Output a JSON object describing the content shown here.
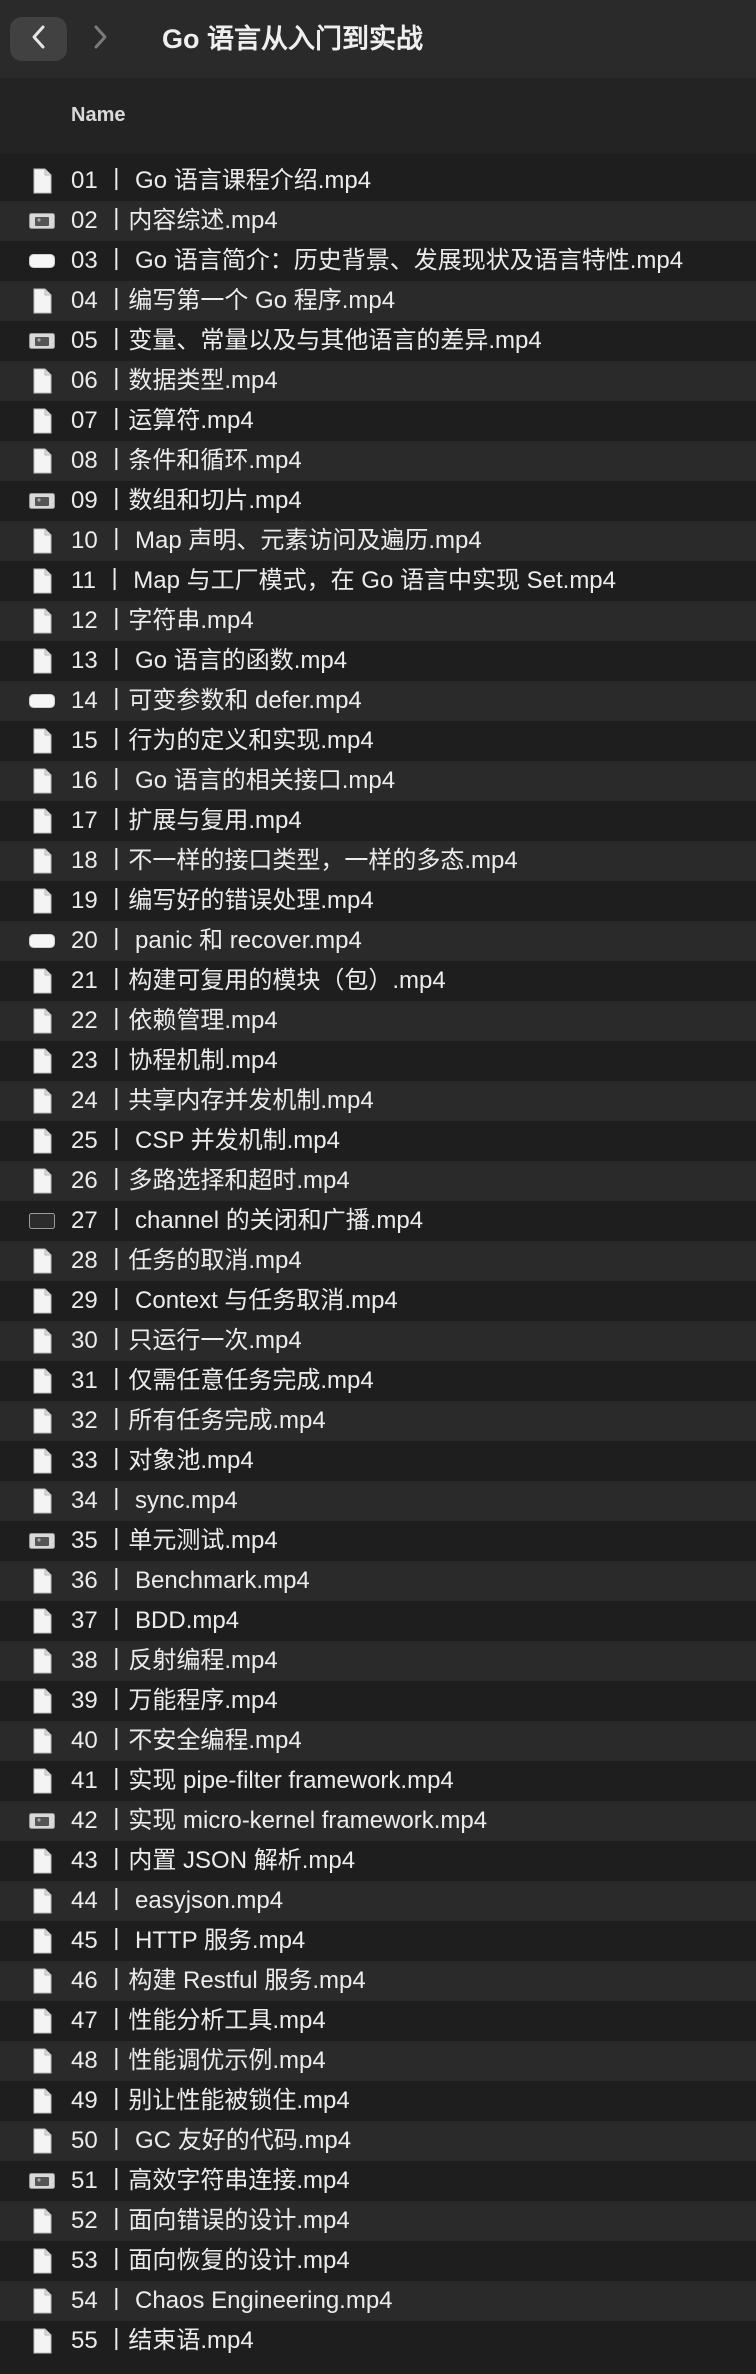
{
  "window": {
    "title": "Go 语言从入门到实战",
    "back_icon": "chevron-left-icon",
    "forward_icon": "chevron-right-icon"
  },
  "header": {
    "name_column": "Name"
  },
  "files": [
    {
      "name": "01 丨 Go 语言课程介绍.mp4",
      "icon": "document-icon"
    },
    {
      "name": "02 丨内容综述.mp4",
      "icon": "image-thumbnail-icon"
    },
    {
      "name": "03 丨 Go 语言简介：历史背景、发展现状及语言特性.mp4",
      "icon": "blank-thumbnail-icon"
    },
    {
      "name": "04 丨编写第一个 Go 程序.mp4",
      "icon": "document-icon"
    },
    {
      "name": "05 丨变量、常量以及与其他语言的差异.mp4",
      "icon": "image-thumbnail-icon"
    },
    {
      "name": "06 丨数据类型.mp4",
      "icon": "document-icon"
    },
    {
      "name": "07 丨运算符.mp4",
      "icon": "document-icon"
    },
    {
      "name": "08 丨条件和循环.mp4",
      "icon": "document-icon"
    },
    {
      "name": "09 丨数组和切片.mp4",
      "icon": "image-thumbnail-icon"
    },
    {
      "name": "10 丨 Map 声明、元素访问及遍历.mp4",
      "icon": "document-icon"
    },
    {
      "name": "11 丨 Map 与工厂模式，在 Go 语言中实现 Set.mp4",
      "icon": "document-icon"
    },
    {
      "name": "12 丨字符串.mp4",
      "icon": "document-icon"
    },
    {
      "name": "13 丨 Go 语言的函数.mp4",
      "icon": "document-icon"
    },
    {
      "name": "14 丨可变参数和 defer.mp4",
      "icon": "blank-thumbnail-icon"
    },
    {
      "name": "15 丨行为的定义和实现.mp4",
      "icon": "document-icon"
    },
    {
      "name": "16 丨 Go 语言的相关接口.mp4",
      "icon": "document-icon"
    },
    {
      "name": "17 丨扩展与复用.mp4",
      "icon": "document-icon"
    },
    {
      "name": "18 丨不一样的接口类型，一样的多态.mp4",
      "icon": "document-icon"
    },
    {
      "name": "19 丨编写好的错误处理.mp4",
      "icon": "document-icon"
    },
    {
      "name": "20 丨 panic 和 recover.mp4",
      "icon": "blank-thumbnail-icon"
    },
    {
      "name": "21 丨构建可复用的模块（包）.mp4",
      "icon": "document-icon"
    },
    {
      "name": "22 丨依赖管理.mp4",
      "icon": "document-icon"
    },
    {
      "name": "23 丨协程机制.mp4",
      "icon": "document-icon"
    },
    {
      "name": "24 丨共享内存并发机制.mp4",
      "icon": "document-icon"
    },
    {
      "name": "25 丨 CSP 并发机制.mp4",
      "icon": "document-icon"
    },
    {
      "name": "26 丨多路选择和超时.mp4",
      "icon": "document-icon"
    },
    {
      "name": "27 丨 channel 的关闭和广播.mp4",
      "icon": "dark-thumbnail-icon"
    },
    {
      "name": "28 丨任务的取消.mp4",
      "icon": "document-icon"
    },
    {
      "name": "29 丨 Context 与任务取消.mp4",
      "icon": "document-icon"
    },
    {
      "name": "30 丨只运行一次.mp4",
      "icon": "document-icon"
    },
    {
      "name": "31 丨仅需任意任务完成.mp4",
      "icon": "document-icon"
    },
    {
      "name": "32 丨所有任务完成.mp4",
      "icon": "document-icon"
    },
    {
      "name": "33 丨对象池.mp4",
      "icon": "document-icon"
    },
    {
      "name": "34 丨 sync.mp4",
      "icon": "document-icon"
    },
    {
      "name": "35 丨单元测试.mp4",
      "icon": "image-thumbnail-icon"
    },
    {
      "name": "36 丨 Benchmark.mp4",
      "icon": "document-icon"
    },
    {
      "name": "37 丨 BDD.mp4",
      "icon": "document-icon"
    },
    {
      "name": "38 丨反射编程.mp4",
      "icon": "document-icon"
    },
    {
      "name": "39 丨万能程序.mp4",
      "icon": "document-icon"
    },
    {
      "name": "40 丨不安全编程.mp4",
      "icon": "document-icon"
    },
    {
      "name": "41 丨实现 pipe-filter framework.mp4",
      "icon": "document-icon"
    },
    {
      "name": "42 丨实现 micro-kernel framework.mp4",
      "icon": "image-thumbnail-icon"
    },
    {
      "name": "43 丨内置 JSON 解析.mp4",
      "icon": "document-icon"
    },
    {
      "name": "44 丨 easyjson.mp4",
      "icon": "document-icon"
    },
    {
      "name": "45 丨 HTTP 服务.mp4",
      "icon": "document-icon"
    },
    {
      "name": "46 丨构建 Restful 服务.mp4",
      "icon": "document-icon"
    },
    {
      "name": "47 丨性能分析工具.mp4",
      "icon": "document-icon"
    },
    {
      "name": "48 丨性能调优示例.mp4",
      "icon": "document-icon"
    },
    {
      "name": "49 丨别让性能被锁住.mp4",
      "icon": "document-icon"
    },
    {
      "name": "50 丨 GC 友好的代码.mp4",
      "icon": "document-icon"
    },
    {
      "name": "51 丨高效字符串连接.mp4",
      "icon": "image-thumbnail-icon"
    },
    {
      "name": "52 丨面向错误的设计.mp4",
      "icon": "document-icon"
    },
    {
      "name": "53 丨面向恢复的设计.mp4",
      "icon": "document-icon"
    },
    {
      "name": "54 丨 Chaos Engineering.mp4",
      "icon": "document-icon"
    },
    {
      "name": "55 丨结束语.mp4",
      "icon": "document-icon"
    }
  ]
}
